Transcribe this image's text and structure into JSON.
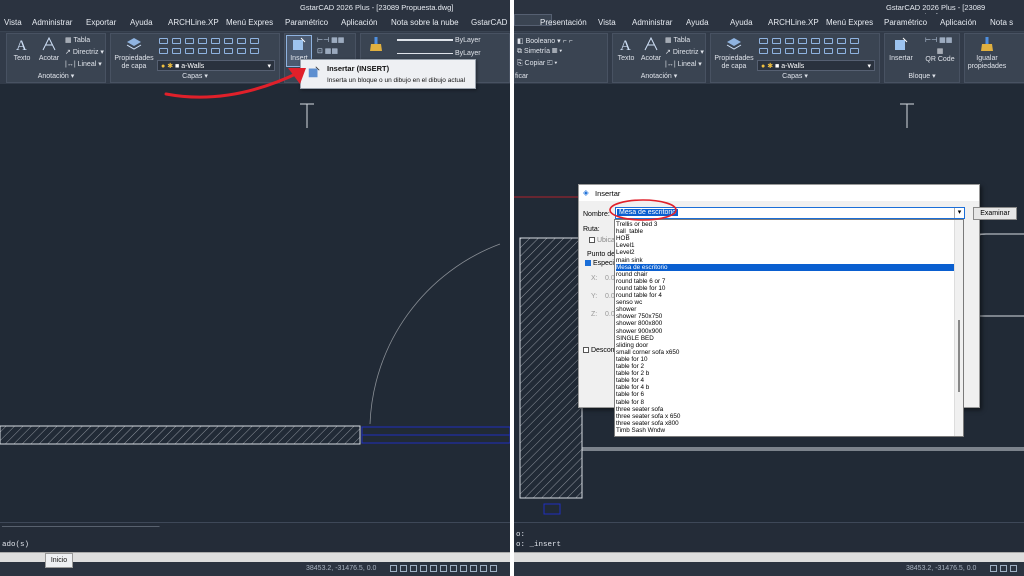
{
  "left": {
    "title": "GstarCAD 2026 Plus - [23089 Propuesta.dwg]",
    "menu": [
      "Vista",
      "Administrar",
      "Exportar",
      "Ayuda",
      "ARCHLine.XP",
      "Menú Expres",
      "Paramétrico",
      "Aplicación",
      "Nota sobre la nube",
      "GstarCAD 3"
    ],
    "ribbon": {
      "text_label": "Texto",
      "dim_label": "Acotar",
      "table_label": "Tabla",
      "multileader_label": "Directriz",
      "linear_label": "Lineal",
      "annotation_group": "Anotación",
      "layer_props_label": "Propiedades de capa",
      "layer_current": "a-Walls",
      "layers_group": "Capas",
      "insert_label": "Insert",
      "bylayer1": "ByLayer",
      "bylayer2": "ByLayer"
    },
    "tooltip": {
      "title": "Insertar (INSERT)",
      "desc": "Inserta un bloque o un dibujo en el dibujo actual"
    },
    "command_line": "ado(s)",
    "tooltip_tab": "Inicio",
    "coords": "38453.2, -31476.5, 0.0"
  },
  "right": {
    "title": "GstarCAD 2026 Plus - [23089 Propuesta.dwg]",
    "menu": [
      "Presentación",
      "Vista",
      "Administrar",
      "Ayuda",
      "ARCHLine.XP",
      "Menú Expres",
      "Paramétrico",
      "Aplicación",
      "Nota s"
    ],
    "ribbon": {
      "boolean_label": "Booleano",
      "symmetry_label": "Simetría",
      "copy_label": "Copiar",
      "modify_label": "ficar",
      "text_label": "Texto",
      "dim_label": "Acotar",
      "table_label": "Tabla",
      "multileader_label": "Directriz",
      "linear_label": "Lineal",
      "annotation_group": "Anotación",
      "layer_props_label": "Propiedades de capa",
      "layer_current": "a-Walls",
      "layers_group": "Capas",
      "insert_label": "Insertar",
      "qr_label": "QR Code",
      "block_group": "Bloque",
      "match_label": "Igualar propiedades"
    },
    "dialog": {
      "title": "Insertar",
      "name_label": "Nombre:",
      "name_value": "Mesa de escritorio",
      "browse_button": "Examinar",
      "path_label": "Ruta:",
      "locate_label": "Ubicar",
      "insertion_label": "Punto de",
      "specify_label": "Especi",
      "x_label": "X:",
      "y_label": "Y:",
      "z_label": "Z:",
      "x_value": "0.0",
      "y_value": "0.0",
      "z_value": "0.0",
      "explode_label": "Descom"
    },
    "list_items": [
      "Trellis or bed 3",
      "hall_table",
      "HOB",
      "Level1",
      "Level2",
      "main sink",
      "Mesa de escritorio",
      "round chair",
      "round table 6 or 7",
      "round table for 10",
      "round table for 4",
      "senso wc",
      "shower",
      "shower 750x750",
      "shower 800x800",
      "shower 900x900",
      "SINGLE BED",
      "sliding door",
      "small corner sofa x650",
      "table for 10",
      "table for 2",
      "table for 2 b",
      "table for 4",
      "table for 4 b",
      "table for 6",
      "table for 8",
      "three seater sofa",
      "three seater sofa x 650",
      "three seater sofa x800",
      "Timb Sash Wndw"
    ],
    "selected_index": 6,
    "command_lines": [
      "o:",
      "o: _insert"
    ],
    "coords": "38453.2, -31476.5, 0.0"
  },
  "colors": {
    "background": "#212a36",
    "ribbon": "#323b49",
    "selection": "#0a5fd0",
    "annotation_red": "#e0202a",
    "hatch": "#d8dce2",
    "blue_lines": "#1e2fbf"
  }
}
